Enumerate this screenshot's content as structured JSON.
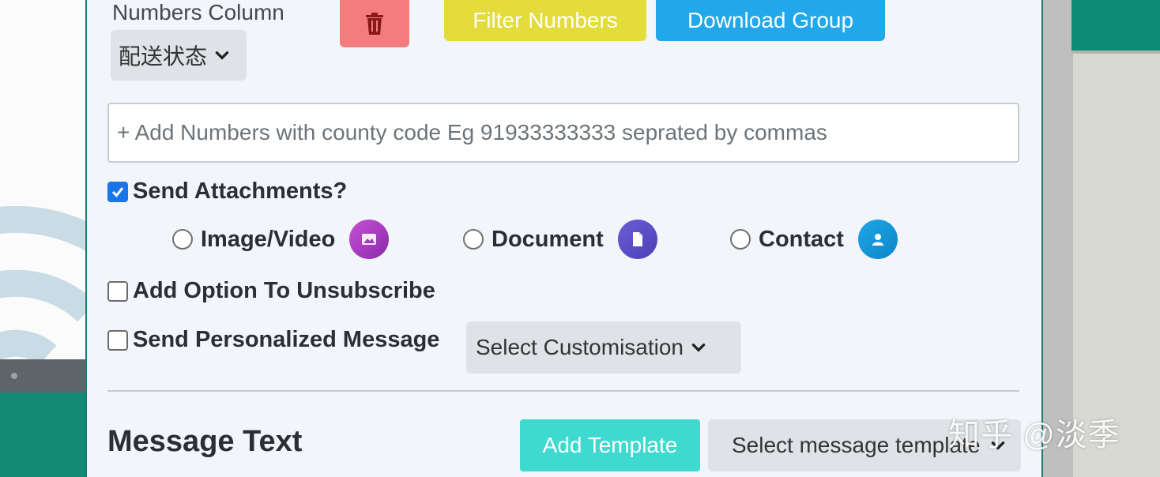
{
  "header": {
    "numbers_column_label": "Numbers Column",
    "numbers_column_value": "配送状态",
    "filter_label": "Filter Numbers",
    "download_label": "Download Group"
  },
  "numbers_input": {
    "placeholder": "+ Add Numbers with county code Eg 91933333333 seprated by commas",
    "value": ""
  },
  "attachments": {
    "label": "Send Attachments?",
    "checked": true,
    "options": [
      {
        "label": "Image/Video",
        "icon": "image-icon",
        "color": "#a03cc0"
      },
      {
        "label": "Document",
        "icon": "document-icon",
        "color": "#5a4fc8"
      },
      {
        "label": "Contact",
        "icon": "contact-icon",
        "color": "#1596d8"
      }
    ]
  },
  "unsubscribe": {
    "label": "Add Option To Unsubscribe",
    "checked": false
  },
  "personalized": {
    "label": "Send Personalized Message",
    "checked": false,
    "select_value": "Select Customisation"
  },
  "message": {
    "title": "Message Text",
    "add_template_label": "Add Template",
    "template_select_value": "Select message template"
  },
  "watermark": "知乎 @淡季",
  "colors": {
    "filter": "#e3dc3a",
    "download": "#22a8ea",
    "delete": "#f47c7c",
    "add_template": "#3ed9cf",
    "checkbox_checked": "#1976e8"
  }
}
